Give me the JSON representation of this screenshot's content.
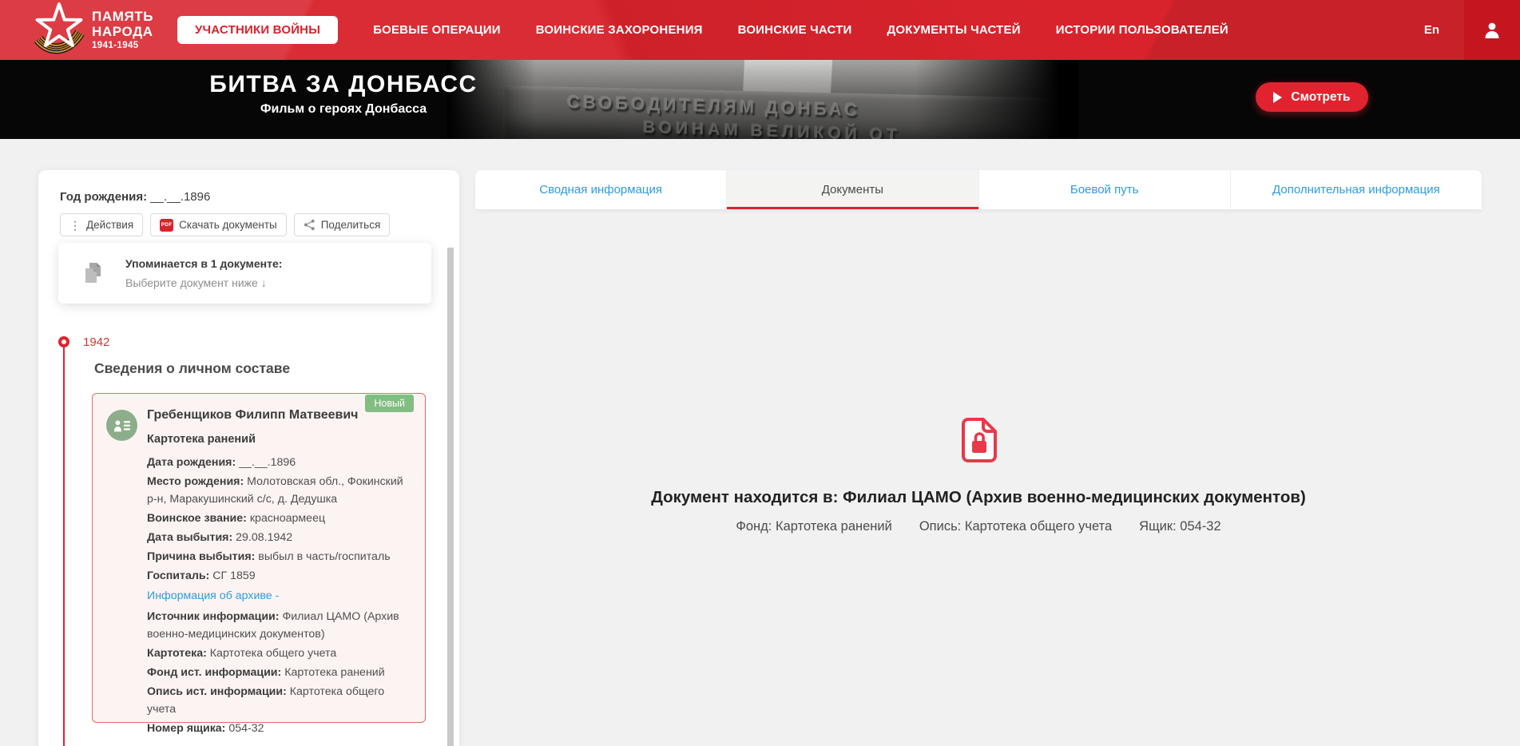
{
  "nav": {
    "logo": {
      "line1": "ПАМЯТЬ",
      "line2": "НАРОДА",
      "years": "1941-1945"
    },
    "items": [
      {
        "label": "УЧАСТНИКИ ВОЙНЫ",
        "active": true
      },
      {
        "label": "БОЕВЫЕ ОПЕРАЦИИ"
      },
      {
        "label": "ВОИНСКИЕ ЗАХОРОНЕНИЯ"
      },
      {
        "label": "ВОИНСКИЕ ЧАСТИ"
      },
      {
        "label": "ДОКУМЕНТЫ ЧАСТЕЙ"
      },
      {
        "label": "ИСТОРИИ ПОЛЬЗОВАТЕЛЕЙ"
      }
    ],
    "lang": "En"
  },
  "banner": {
    "title": "БИТВА ЗА ДОНБАСС",
    "subtitle": "Фильм о героях Донбасса",
    "watch_label": "Смотреть",
    "monument_line1": "СВОБОДИТЕЛЯМ ДОНБАС",
    "monument_line2": "ВОИНАМ ВЕЛИКОЙ ОТ"
  },
  "tabs": {
    "items": [
      {
        "label": "Сводная информация"
      },
      {
        "label": "Документы",
        "active": true
      },
      {
        "label": "Боевой путь"
      },
      {
        "label": "Дополнительная информация"
      }
    ]
  },
  "sidebar": {
    "birth": {
      "label": "Год рождения:",
      "value": "__.__.1896"
    },
    "actions": {
      "actions_label": "Действия",
      "download_label": "Скачать документы",
      "share_label": "Поделиться",
      "pdf_badge": "PDF",
      "kebab_glyph": "⋮"
    },
    "mention": {
      "title": "Упоминается в 1 документе:",
      "subtitle": "Выберите документ ниже  ↓"
    },
    "timeline": {
      "year": "1942",
      "section_title": "Сведения о личном составе"
    },
    "card": {
      "badge": "Новый",
      "name": "Гребенщиков Филипп Матвеевич",
      "doc_type": "Картотека ранений",
      "fields": [
        {
          "label": "Дата рождения:",
          "value": "__.__.1896"
        },
        {
          "label": "Место рождения:",
          "value": "Молотовская обл., Фокинский р-н, Маракушинский с/с, д. Дедушка"
        },
        {
          "label": "Воинское звание:",
          "value": "красноармеец"
        },
        {
          "label": "Дата выбытия:",
          "value": "29.08.1942"
        },
        {
          "label": "Причина выбытия:",
          "value": "выбыл в часть/госпиталь"
        },
        {
          "label": "Госпиталь:",
          "value": "СГ 1859"
        }
      ],
      "archive_link": "Информация об архиве -",
      "archive_fields": [
        {
          "label": "Источник информации:",
          "value": "Филиал ЦАМО (Архив военно-медицинских документов)"
        },
        {
          "label": "Картотека:",
          "value": "Картотека общего учета"
        },
        {
          "label": "Фонд ист. информации:",
          "value": "Картотека ранений"
        },
        {
          "label": "Опись ист. информации:",
          "value": "Картотека общего учета"
        },
        {
          "label": "Номер ящика:",
          "value": "054-32"
        }
      ]
    }
  },
  "main": {
    "location_text": "Документ находится в: Филиал ЦАМО (Архив военно-медицинских документов)",
    "meta": [
      {
        "label": "Фонд:",
        "value": "Картотека ранений"
      },
      {
        "label": "Опись:",
        "value": "Картотека общего учета"
      },
      {
        "label": "Ящик:",
        "value": "054-32"
      }
    ]
  },
  "colors": {
    "accent_red": "#D8232C",
    "dark_red": "#C5161F",
    "tab_blue": "#2D9CDB",
    "badge_green": "#82BD82",
    "card_pink": "#FCF4F3"
  }
}
